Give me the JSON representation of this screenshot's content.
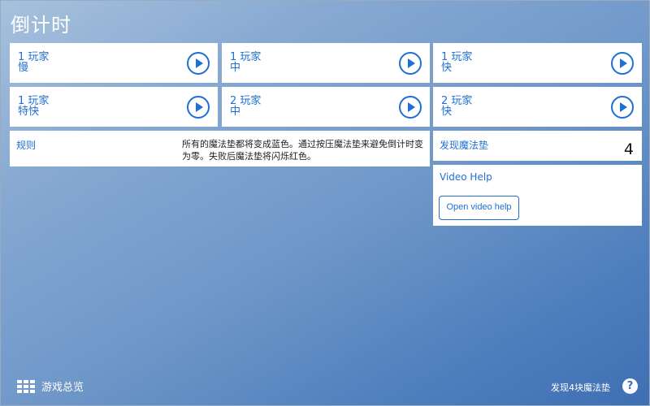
{
  "page": {
    "title": "倒计时"
  },
  "modes": [
    {
      "players": "1 玩家",
      "speed": "慢"
    },
    {
      "players": "1 玩家",
      "speed": "中"
    },
    {
      "players": "1 玩家",
      "speed": "快"
    },
    {
      "players": "1 玩家",
      "speed": "特快"
    },
    {
      "players": "2 玩家",
      "speed": "中"
    },
    {
      "players": "2 玩家",
      "speed": "快"
    }
  ],
  "rules": {
    "title": "规则",
    "text": "所有的魔法垫都将变成蓝色。通过按压魔法垫来避免倒计时变为零。失败后魔法垫将闪烁红色。"
  },
  "found": {
    "label": "发现魔法垫",
    "count": "4"
  },
  "video_help": {
    "title": "Video Help",
    "button": "Open video help"
  },
  "footer": {
    "overview": "游戏总览",
    "status": "发现4块魔法垫",
    "help": "?"
  },
  "icons": {
    "play": "play-icon",
    "grid": "grid-icon",
    "help": "help-icon"
  },
  "colors": {
    "accent": "#1f6fd6",
    "card": "#ffffff"
  }
}
